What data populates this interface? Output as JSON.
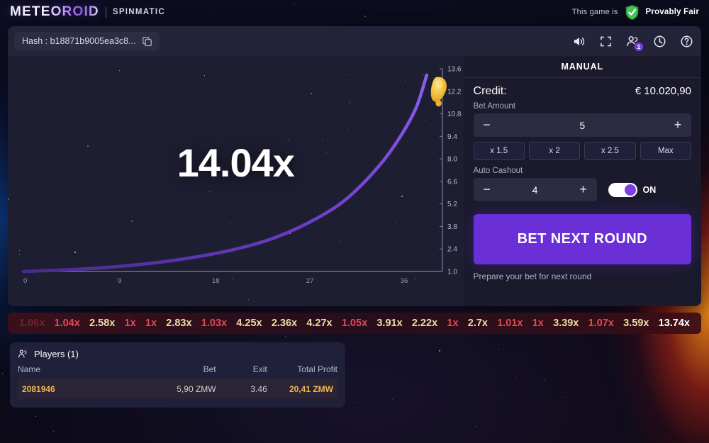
{
  "header": {
    "logo": "METEOROID",
    "provider": "SPINMATIC",
    "fair_prefix": "This game is",
    "fair_label": "Provably Fair",
    "shield_icon": "shield-check-icon"
  },
  "panel": {
    "hash_label": "Hash : b18871b9005ea3c8...",
    "copy_icon": "copy-icon",
    "icons": [
      {
        "name": "volume-icon",
        "badge": ""
      },
      {
        "name": "fullscreen-icon",
        "badge": ""
      },
      {
        "name": "players-icon",
        "badge": "1"
      },
      {
        "name": "history-clock-icon",
        "badge": ""
      },
      {
        "name": "help-icon",
        "badge": ""
      }
    ]
  },
  "chart_data": {
    "type": "line",
    "title": "",
    "multiplier_label": "14.04x",
    "xlabel": "",
    "ylabel": "",
    "x_ticks": [
      "0",
      "9",
      "18",
      "27",
      "36"
    ],
    "y_ticks": [
      "13.6",
      "12.2",
      "10.8",
      "9.4",
      "8.0",
      "6.6",
      "5.2",
      "3.8",
      "2.4",
      "1.0"
    ],
    "xlim": [
      0,
      40
    ],
    "ylim": [
      1.0,
      13.6
    ],
    "grid": false,
    "legend": "none",
    "line_color": "#7b46d6",
    "series": [
      {
        "name": "multiplier-curve",
        "x": [
          0,
          4,
          8,
          12,
          16,
          20,
          24,
          28,
          31,
          34,
          36,
          37.5,
          38.5
        ],
        "values": [
          1.0,
          1.1,
          1.25,
          1.5,
          1.85,
          2.35,
          3.1,
          4.3,
          5.6,
          7.6,
          9.4,
          11.2,
          13.2
        ]
      }
    ],
    "marker": {
      "name": "meteor-icon",
      "color": "#f2c23c",
      "x": 38.5,
      "y": 13.4
    }
  },
  "controls": {
    "mode_tab": "MANUAL",
    "credit_label": "Credit:",
    "credit_value": "€ 10.020,90",
    "bet_amount_label": "Bet Amount",
    "bet_amount_value": "5",
    "minus": "−",
    "plus": "+",
    "multipliers": [
      "x 1.5",
      "x 2",
      "x 2.5",
      "Max"
    ],
    "auto_cashout_label": "Auto Cashout",
    "auto_cashout_value": "4",
    "toggle_state": "ON",
    "bet_button": "BET NEXT ROUND",
    "bet_hint": "Prepare your bet for next round"
  },
  "history": {
    "items": [
      {
        "value": "1.06x",
        "color": "#6e2430"
      },
      {
        "value": "1.04x",
        "color": "#e04a5a"
      },
      {
        "value": "2.58x",
        "color": "#f0dba8"
      },
      {
        "value": "1x",
        "color": "#e04a5a"
      },
      {
        "value": "1x",
        "color": "#e04a5a"
      },
      {
        "value": "2.83x",
        "color": "#f0dba8"
      },
      {
        "value": "1.03x",
        "color": "#e04a5a"
      },
      {
        "value": "4.25x",
        "color": "#f0dba8"
      },
      {
        "value": "2.36x",
        "color": "#f0dba8"
      },
      {
        "value": "4.27x",
        "color": "#f0dba8"
      },
      {
        "value": "1.05x",
        "color": "#e04a5a"
      },
      {
        "value": "3.91x",
        "color": "#f0dba8"
      },
      {
        "value": "2.22x",
        "color": "#f0dba8"
      },
      {
        "value": "1x",
        "color": "#e04a5a"
      },
      {
        "value": "2.7x",
        "color": "#f0dba8"
      },
      {
        "value": "1.01x",
        "color": "#e04a5a"
      },
      {
        "value": "1x",
        "color": "#e04a5a"
      },
      {
        "value": "3.39x",
        "color": "#f0dba8"
      },
      {
        "value": "1.07x",
        "color": "#e04a5a"
      },
      {
        "value": "3.59x",
        "color": "#f0dba8"
      },
      {
        "value": "13.74x",
        "color": "#ffffff"
      }
    ]
  },
  "players": {
    "title": "Players (1)",
    "icon": "players-group-icon",
    "columns": [
      "Name",
      "Bet",
      "Exit",
      "Total Profit"
    ],
    "rows": [
      {
        "name": "2081946",
        "bet": "5,90 ZMW",
        "exit": "3.46",
        "profit": "20,41 ZMW"
      }
    ]
  }
}
